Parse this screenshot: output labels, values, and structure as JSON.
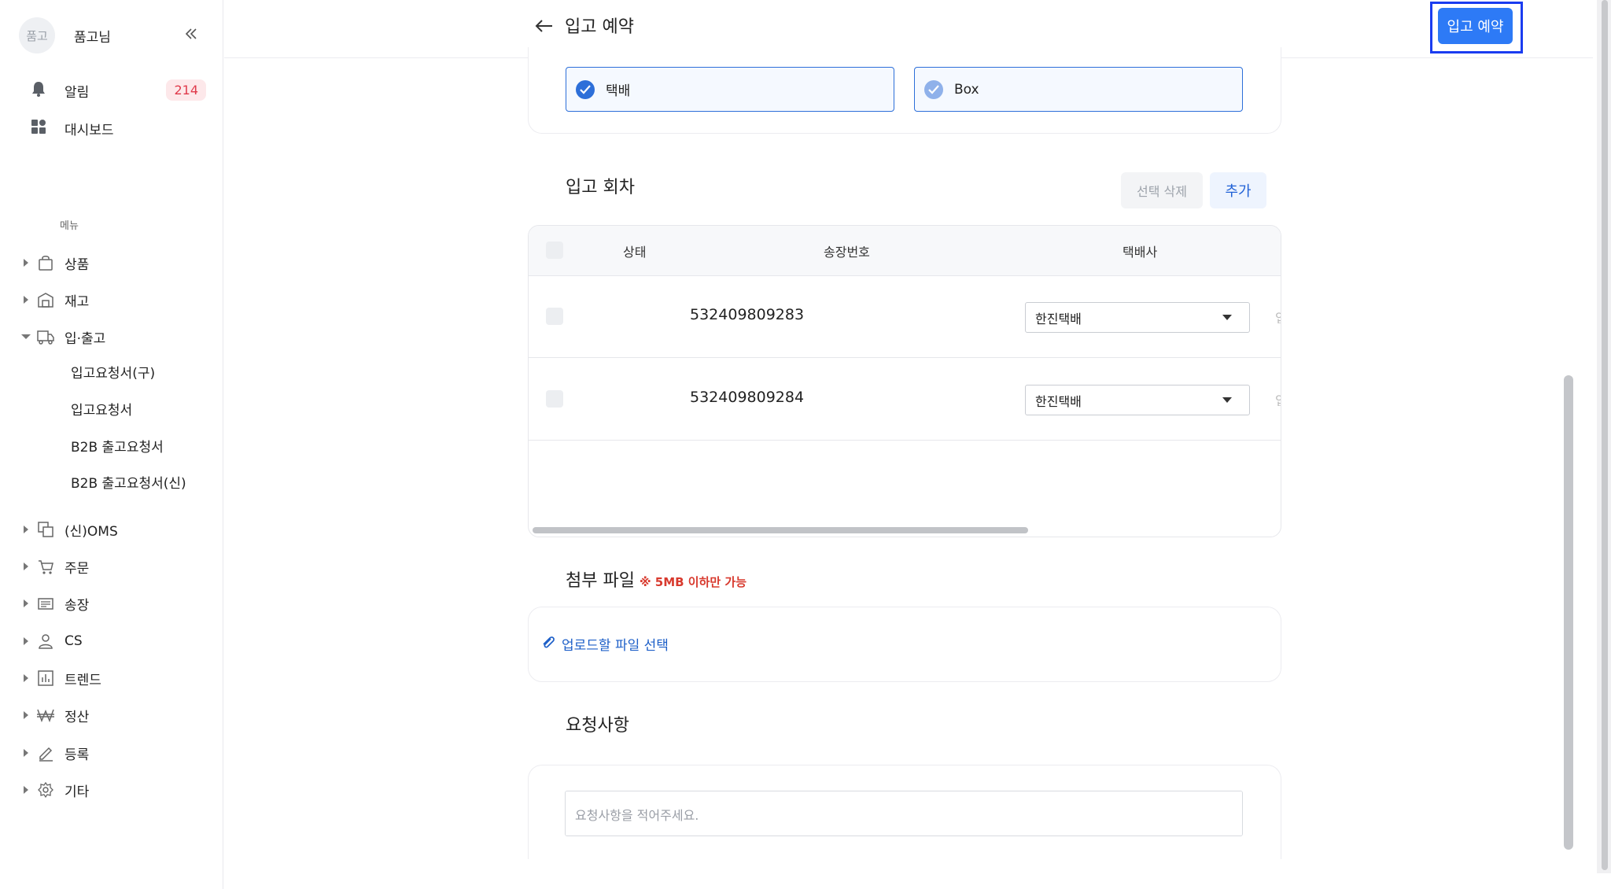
{
  "sidebar": {
    "avatar_text": "품고",
    "profile_name": "품고님",
    "collapse_icon": "double-chevron-left-icon",
    "top_items": [
      {
        "label": "알림",
        "icon": "bell-icon",
        "badge": "214"
      },
      {
        "label": "대시보드",
        "icon": "dashboard-icon"
      }
    ],
    "menu_heading": "메뉴",
    "items": [
      {
        "label": "상품",
        "icon": "bag-icon",
        "expanded": false
      },
      {
        "label": "재고",
        "icon": "warehouse-icon",
        "expanded": false
      },
      {
        "label": "입·출고",
        "icon": "truck-icon",
        "expanded": true
      },
      {
        "label": "(신)OMS",
        "icon": "oms-icon",
        "expanded": false
      },
      {
        "label": "주문",
        "icon": "cart-icon",
        "expanded": false
      },
      {
        "label": "송장",
        "icon": "invoice-icon",
        "expanded": false
      },
      {
        "label": "CS",
        "icon": "person-icon",
        "expanded": false
      },
      {
        "label": "트렌드",
        "icon": "bar-chart-icon",
        "expanded": false
      },
      {
        "label": "정산",
        "icon": "won-icon",
        "expanded": false
      },
      {
        "label": "등록",
        "icon": "pencil-icon",
        "expanded": false
      },
      {
        "label": "기타",
        "icon": "gear-icon",
        "expanded": false
      }
    ],
    "sub_items": [
      "입고요청서(구)",
      "입고요청서",
      "B2B 출고요청서",
      "B2B 출고요청서(신)"
    ]
  },
  "header": {
    "title": "입고 예약",
    "primary_button": "입고 예약"
  },
  "shipping_options": [
    {
      "label": "택배",
      "checked": true
    },
    {
      "label": "Box",
      "checked": true
    }
  ],
  "rounds": {
    "title": "입고 회차",
    "delete_button": "선택 삭제",
    "add_button": "추가",
    "columns": [
      "상태",
      "송장번호",
      "택배사"
    ],
    "rows": [
      {
        "tracking": "532409809283",
        "carrier": "한진택배"
      },
      {
        "tracking": "532409809284",
        "carrier": "한진택배"
      }
    ]
  },
  "attachment": {
    "title": "첨부 파일",
    "note": "※ 5MB 이하만 가능",
    "upload_label": "업로드할 파일 선택"
  },
  "request": {
    "title": "요청사항",
    "placeholder": "요청사항을 적어주세요."
  },
  "colors": {
    "primary": "#2d7af6",
    "link": "#1d5fc8",
    "warning": "#d83a2e",
    "badge_bg": "#fde8ea",
    "badge_text": "#e03a4b"
  }
}
